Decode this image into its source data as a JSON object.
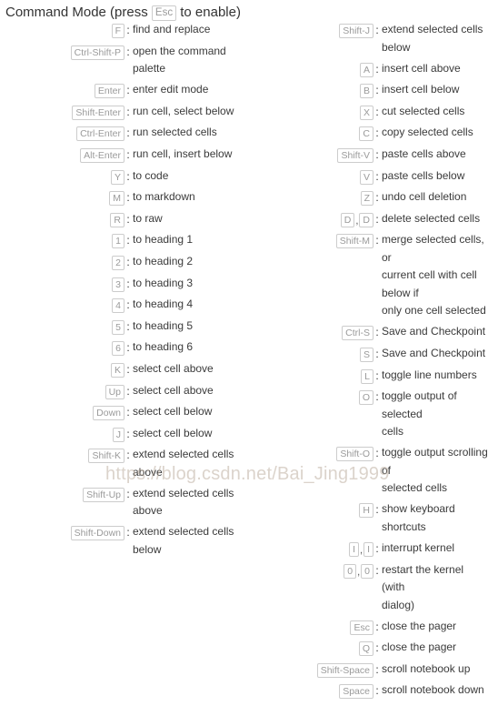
{
  "header": {
    "prefix": "Command Mode (press",
    "key": "Esc",
    "suffix": "to enable)"
  },
  "watermark": "https://blog.csdn.net/Bai_Jing1999",
  "colon": ":",
  "comma": ",",
  "columns": {
    "left": [
      {
        "keys": [
          "F"
        ],
        "desc": [
          "find and replace"
        ]
      },
      {
        "keys": [
          "Ctrl-Shift-P"
        ],
        "desc": [
          "open the command palette"
        ]
      },
      {
        "keys": [
          "Enter"
        ],
        "desc": [
          "enter edit mode"
        ]
      },
      {
        "keys": [
          "Shift-Enter"
        ],
        "desc": [
          "run cell, select below"
        ]
      },
      {
        "keys": [
          "Ctrl-Enter"
        ],
        "desc": [
          "run selected cells"
        ]
      },
      {
        "keys": [
          "Alt-Enter"
        ],
        "desc": [
          "run cell, insert below"
        ]
      },
      {
        "keys": [
          "Y"
        ],
        "desc": [
          "to code"
        ]
      },
      {
        "keys": [
          "M"
        ],
        "desc": [
          "to markdown"
        ]
      },
      {
        "keys": [
          "R"
        ],
        "desc": [
          "to raw"
        ]
      },
      {
        "keys": [
          "1"
        ],
        "desc": [
          "to heading 1"
        ]
      },
      {
        "keys": [
          "2"
        ],
        "desc": [
          "to heading 2"
        ]
      },
      {
        "keys": [
          "3"
        ],
        "desc": [
          "to heading 3"
        ]
      },
      {
        "keys": [
          "4"
        ],
        "desc": [
          "to heading 4"
        ]
      },
      {
        "keys": [
          "5"
        ],
        "desc": [
          "to heading 5"
        ]
      },
      {
        "keys": [
          "6"
        ],
        "desc": [
          "to heading 6"
        ]
      },
      {
        "keys": [
          "K"
        ],
        "desc": [
          "select cell above"
        ]
      },
      {
        "keys": [
          "Up"
        ],
        "desc": [
          "select cell above"
        ]
      },
      {
        "keys": [
          "Down"
        ],
        "desc": [
          "select cell below"
        ]
      },
      {
        "keys": [
          "J"
        ],
        "desc": [
          "select cell below"
        ]
      },
      {
        "keys": [
          "Shift-K"
        ],
        "desc": [
          "extend selected cells above"
        ]
      },
      {
        "keys": [
          "Shift-Up"
        ],
        "desc": [
          "extend selected cells above"
        ]
      },
      {
        "keys": [
          "Shift-Down"
        ],
        "desc": [
          "extend selected cells below"
        ]
      }
    ],
    "right": [
      {
        "keys": [
          "Shift-J"
        ],
        "desc": [
          "extend selected cells below"
        ]
      },
      {
        "keys": [
          "A"
        ],
        "desc": [
          "insert cell above"
        ]
      },
      {
        "keys": [
          "B"
        ],
        "desc": [
          "insert cell below"
        ]
      },
      {
        "keys": [
          "X"
        ],
        "desc": [
          "cut selected cells"
        ]
      },
      {
        "keys": [
          "C"
        ],
        "desc": [
          "copy selected cells"
        ]
      },
      {
        "keys": [
          "Shift-V"
        ],
        "desc": [
          "paste cells above"
        ]
      },
      {
        "keys": [
          "V"
        ],
        "desc": [
          "paste cells below"
        ]
      },
      {
        "keys": [
          "Z"
        ],
        "desc": [
          "undo cell deletion"
        ]
      },
      {
        "keys": [
          "D",
          "D"
        ],
        "desc": [
          "delete selected cells"
        ]
      },
      {
        "keys": [
          "Shift-M"
        ],
        "desc": [
          "merge selected cells, or",
          "current cell with cell below if",
          "only one cell selected"
        ]
      },
      {
        "keys": [
          "Ctrl-S"
        ],
        "desc": [
          "Save and Checkpoint"
        ]
      },
      {
        "keys": [
          "S"
        ],
        "desc": [
          "Save and Checkpoint"
        ]
      },
      {
        "keys": [
          "L"
        ],
        "desc": [
          "toggle line numbers"
        ]
      },
      {
        "keys": [
          "O"
        ],
        "desc": [
          "toggle output of selected",
          "cells"
        ]
      },
      {
        "keys": [
          "Shift-O"
        ],
        "desc": [
          "toggle output scrolling of",
          "selected cells"
        ]
      },
      {
        "keys": [
          "H"
        ],
        "desc": [
          "show keyboard shortcuts"
        ]
      },
      {
        "keys": [
          "I",
          "I"
        ],
        "desc": [
          "interrupt kernel"
        ]
      },
      {
        "keys": [
          "0",
          "0"
        ],
        "desc": [
          "restart the kernel (with",
          "dialog)"
        ]
      },
      {
        "keys": [
          "Esc"
        ],
        "desc": [
          "close the pager"
        ]
      },
      {
        "keys": [
          "Q"
        ],
        "desc": [
          "close the pager"
        ]
      },
      {
        "keys": [
          "Shift-Space"
        ],
        "desc": [
          "scroll notebook up"
        ]
      },
      {
        "keys": [
          "Space"
        ],
        "desc": [
          "scroll notebook down"
        ]
      }
    ]
  }
}
